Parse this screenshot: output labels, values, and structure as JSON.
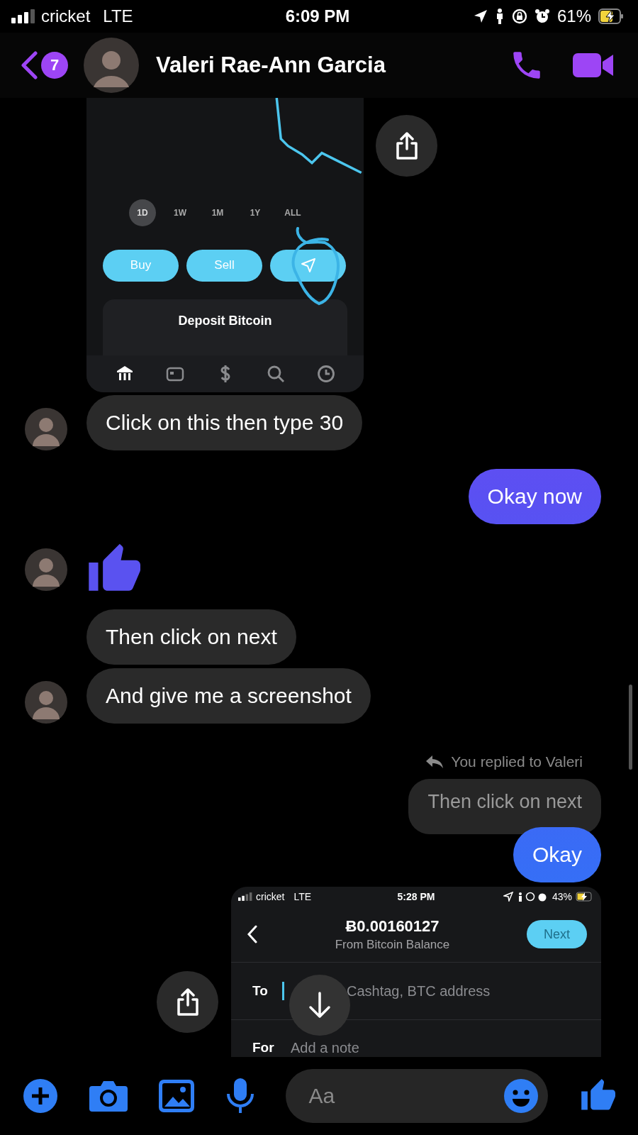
{
  "status_bar": {
    "carrier": "cricket",
    "network": "LTE",
    "time": "6:09 PM",
    "battery": "61%",
    "charging": true
  },
  "header": {
    "unread_count": "7",
    "contact_name": "Valeri Rae-Ann Garcia"
  },
  "messages": [
    {
      "kind": "crypto_screenshot",
      "periods": [
        {
          "label": "1D",
          "selected": true
        },
        {
          "label": "1W",
          "selected": false
        },
        {
          "label": "1M",
          "selected": false
        },
        {
          "label": "1Y",
          "selected": false
        },
        {
          "label": "ALL",
          "selected": false
        }
      ],
      "actions": [
        "Buy",
        "Sell"
      ],
      "card_title": "Deposit Bitcoin",
      "nav": [
        {
          "selected": true
        },
        {
          "selected": false
        },
        {
          "selected": false
        },
        {
          "selected": false
        },
        {
          "selected": false
        }
      ]
    },
    {
      "kind": "incoming_text",
      "text": "Click on this then type 30",
      "avatar": true
    },
    {
      "kind": "outgoing_text",
      "text": "Okay now"
    },
    {
      "kind": "like",
      "avatar": true
    },
    {
      "kind": "incoming_text",
      "text": "Then click on next",
      "avatar": false
    },
    {
      "kind": "incoming_text",
      "text": "And give me a screenshot",
      "avatar": true
    },
    {
      "kind": "reply",
      "reply_label": "You replied to Valeri",
      "quote": "Then click on next",
      "text": "Okay"
    },
    {
      "kind": "send_screenshot",
      "status": {
        "carrier": "cricket",
        "network": "LTE",
        "time": "5:28 PM",
        "battery": "43%"
      },
      "amount": "Ƀ0.00160127",
      "source": "From Bitcoin Balance",
      "next": {
        "label": "Next",
        "disabled": true
      },
      "fields": [
        {
          "label": "To",
          "placeholder": "Cashtag, BTC address",
          "cursor": true
        },
        {
          "label": "For",
          "placeholder": "Add a note",
          "cursor": false
        }
      ]
    }
  ],
  "composer": {
    "placeholder": "Aa"
  }
}
